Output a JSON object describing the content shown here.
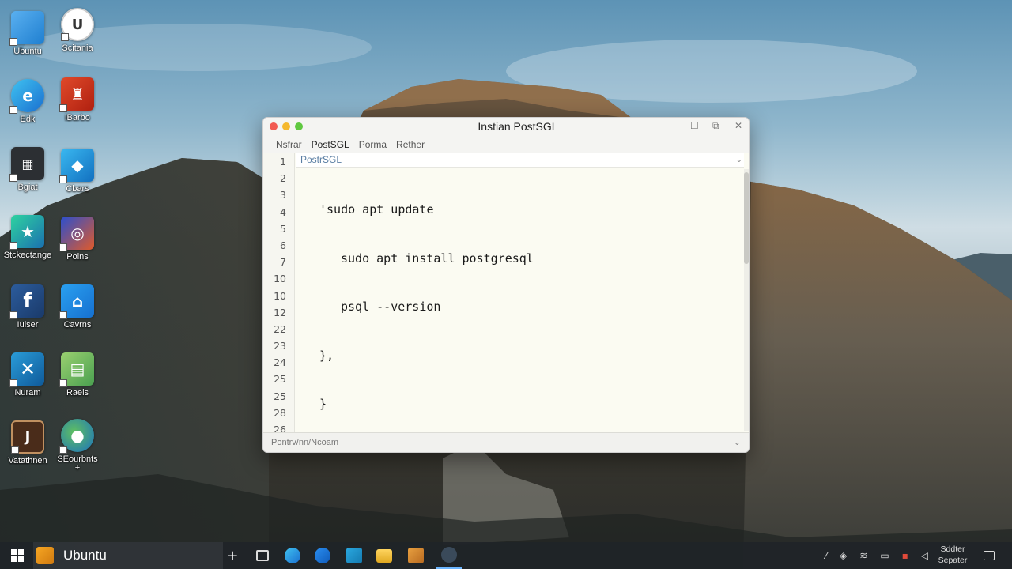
{
  "desktop": {
    "icons": [
      {
        "label": "Ubuntu"
      },
      {
        "label": "Scitania"
      },
      {
        "label": "Edk"
      },
      {
        "label": "iBarbo"
      },
      {
        "label": "Bgiat"
      },
      {
        "label": "Cbars"
      },
      {
        "label": "Stckectange"
      },
      {
        "label": "Poins"
      },
      {
        "label": "Iuiser"
      },
      {
        "label": "Cavrns"
      },
      {
        "label": "Nuram"
      },
      {
        "label": "Raels"
      },
      {
        "label": "Vatathnen"
      },
      {
        "label": "SEourbnts"
      }
    ],
    "extra_plus": "+"
  },
  "window": {
    "title": "Instian PostSGL",
    "menu": [
      "Nsfrar",
      "PostSGL",
      "Porma",
      "Rether"
    ],
    "tab_label": "PostrSGL",
    "gutter_lines": [
      "1",
      "2",
      "3",
      "4",
      "5",
      "6",
      "7",
      "10",
      "10",
      "12",
      "22",
      "23",
      "24",
      "25",
      "25",
      "28",
      "26"
    ],
    "code_lines": [
      {
        "prefix": "'",
        "text": "sudo apt update"
      },
      {
        "prefix": "  ",
        "text": "sudo apt install postgresql"
      },
      {
        "prefix": "  ",
        "text": "psql --version"
      },
      {
        "prefix": "},",
        "text": ""
      },
      {
        "prefix": "}",
        "text": ""
      }
    ],
    "status_text": "Pontrv/nn/Ncoam",
    "controls": {
      "minimize": "—",
      "maximize": "☐",
      "restore": "⧉",
      "close": "✕"
    }
  },
  "taskbar": {
    "app_label": "Ubuntu",
    "plus": "+",
    "clock_line1": "Sddter",
    "clock_line2": "Sepater"
  },
  "colors": {
    "traffic_red": "#f25a52",
    "traffic_yellow": "#f5b82e",
    "traffic_green": "#5fc840",
    "code_green": "#1f5f4f",
    "taskbar_bg": "#202428"
  }
}
